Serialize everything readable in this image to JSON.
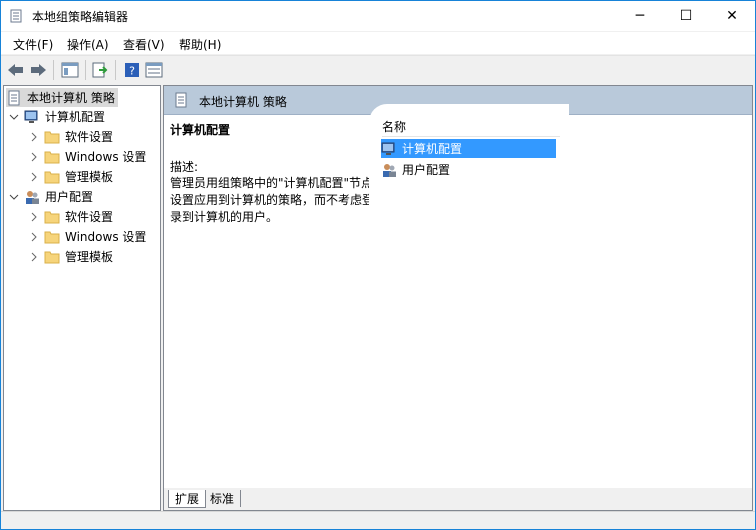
{
  "window": {
    "title": "本地组策略编辑器",
    "controls": {
      "minimize_icon": "─",
      "maximize_icon": "☐",
      "close_icon": "✕"
    }
  },
  "menu": [
    {
      "label": "文件(F)"
    },
    {
      "label": "操作(A)"
    },
    {
      "label": "查看(V)"
    },
    {
      "label": "帮助(H)"
    }
  ],
  "toolbar": {
    "icons": [
      "back-icon",
      "forward-icon",
      "show-hide-tree-icon",
      "export-list-icon",
      "help-icon",
      "properties-icon"
    ]
  },
  "tree": {
    "root": "本地计算机 策略",
    "computer_config": {
      "label": "计算机配置",
      "children": [
        "软件设置",
        "Windows 设置",
        "管理模板"
      ]
    },
    "user_config": {
      "label": "用户配置",
      "children": [
        "软件设置",
        "Windows 设置",
        "管理模板"
      ]
    }
  },
  "detail": {
    "header_title": "本地计算机 策略",
    "selected_title": "计算机配置",
    "desc_label": "描述:",
    "desc_text": "管理员用组策略中的\"计算机配置\"节点设置应用到计算机的策略，而不考虑登录到计算机的用户。"
  },
  "list": {
    "column_name": "名称",
    "items": [
      {
        "label": "计算机配置",
        "selected": true
      },
      {
        "label": "用户配置",
        "selected": false
      }
    ]
  },
  "tabs": [
    {
      "label": "扩展",
      "active": true
    },
    {
      "label": "标准",
      "active": false
    }
  ],
  "colors": {
    "accent": "#1783d8",
    "selection": "#3399ff",
    "header_bar": "#b9c9da",
    "folder": "#f6d47b"
  }
}
